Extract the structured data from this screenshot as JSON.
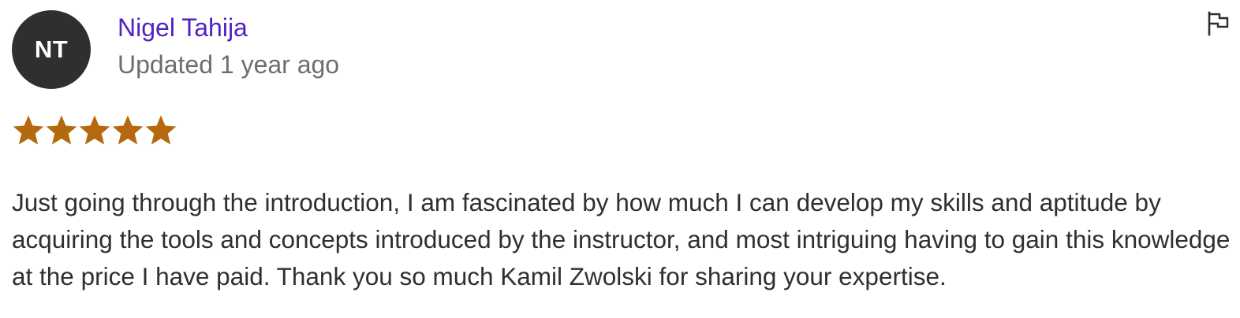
{
  "review": {
    "avatar_initials": "NT",
    "reviewer_name": "Nigel Tahija",
    "updated_text": "Updated 1 year ago",
    "rating": 5,
    "rating_max": 5,
    "review_text": "Just going through the introduction, I am fascinated by how much I can develop my skills and aptitude by acquiring the tools and concepts introduced by the instructor, and most intriguing having to gain this knowledge at the price I have paid. Thank you so much Kamil Zwolski for sharing your expertise.",
    "flag_icon": "flag-icon"
  },
  "colors": {
    "star": "#b4690e",
    "name": "#5022c3",
    "meta": "#6a6f73",
    "text": "#2d2f31",
    "avatar_bg": "#2d2f31"
  }
}
